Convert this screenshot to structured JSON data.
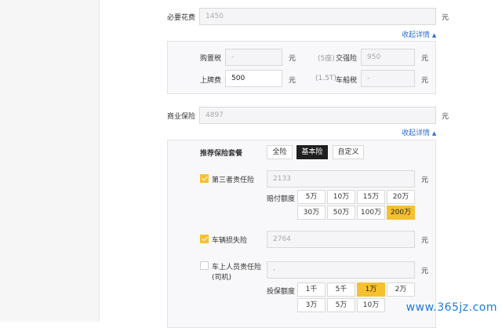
{
  "required_fees": {
    "label": "必要花费",
    "value": "1450",
    "unit": "元",
    "collapse_link": "收起详情",
    "purchase_tax": {
      "label": "购置税",
      "value": "-",
      "unit": "元"
    },
    "compulsory_insurance": {
      "note": "(5座)",
      "label": "交强险",
      "value": "950",
      "unit": "元"
    },
    "license_fee": {
      "label": "上牌费",
      "value": "500",
      "unit": "元"
    },
    "vehicle_tax": {
      "note": "(1.5T)",
      "label": "车船税",
      "value": "-",
      "unit": "元"
    }
  },
  "commercial_insurance": {
    "label": "商业保险",
    "value": "4897",
    "unit": "元",
    "collapse_link": "收起详情",
    "package_label": "推荐保险套餐",
    "packages": [
      "全险",
      "基本险",
      "自定义"
    ],
    "selected_package": "基本险",
    "third_party": {
      "label": "第三者责任险",
      "checked": true,
      "value": "2133",
      "unit": "元",
      "amount_label": "赔付额度",
      "options": [
        "5万",
        "10万",
        "15万",
        "20万",
        "30万",
        "50万",
        "100万",
        "200万"
      ],
      "selected": "200万"
    },
    "vehicle_damage": {
      "label": "车辆损失险",
      "checked": true,
      "value": "2764",
      "unit": "元"
    },
    "passenger": {
      "label_line1": "车上人员责任险",
      "label_line2": "(司机)",
      "checked": false,
      "value": "-",
      "unit": "元",
      "amount_label": "投保额度",
      "options": [
        "1千",
        "5千",
        "1万",
        "2万",
        "3万",
        "5万",
        "10万"
      ],
      "selected": "1万"
    }
  },
  "watermark": "www.365jz.com",
  "colors": {
    "accent": "#f6c12f",
    "link": "#2f6fd6",
    "dark_button": "#1f1f1f"
  },
  "icons": {
    "collapse": "caret-up-icon",
    "check": "checkmark-icon"
  }
}
